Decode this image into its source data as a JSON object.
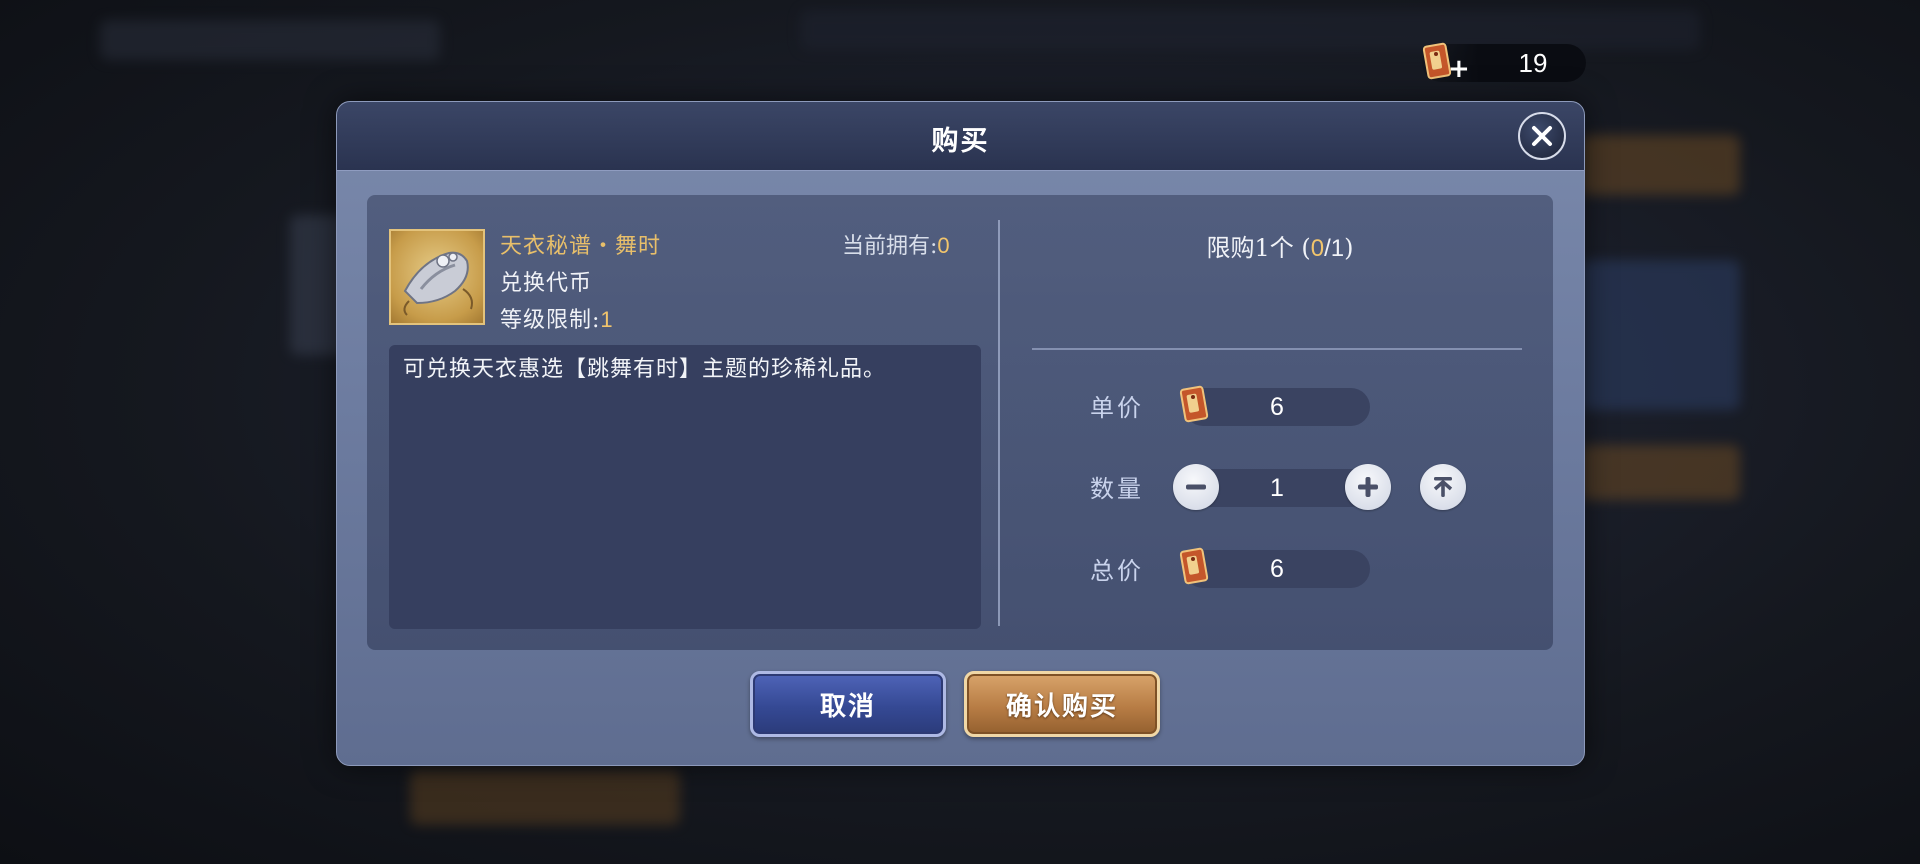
{
  "currency_top": {
    "value": "19",
    "plus": "+"
  },
  "dialog": {
    "title": "购买",
    "item": {
      "name": "天衣秘谱・舞时",
      "owned_label": "当前拥有:",
      "owned_value": "0",
      "type": "兑换代币",
      "level_label": "等级限制:",
      "level_value": "1",
      "description": "可兑换天衣惠选【跳舞有时】主题的珍稀礼品。"
    },
    "limit": {
      "prefix": "限购1个 (",
      "current": "0",
      "max": "/1",
      "suffix": ")"
    },
    "unit_price": {
      "label": "单价",
      "value": "6"
    },
    "quantity": {
      "label": "数量",
      "value": "1"
    },
    "total_price": {
      "label": "总价",
      "value": "6"
    },
    "buttons": {
      "cancel": "取消",
      "confirm": "确认购买"
    }
  },
  "colors": {
    "accent_gold": "#f2c56c",
    "item_name": "#e8bf6a",
    "cancel_blue": "#354994",
    "confirm_orange": "#b87d45"
  },
  "icons": [
    "currency-coin-icon",
    "close-icon",
    "minus-icon",
    "plus-icon",
    "max-icon",
    "item-icon"
  ]
}
